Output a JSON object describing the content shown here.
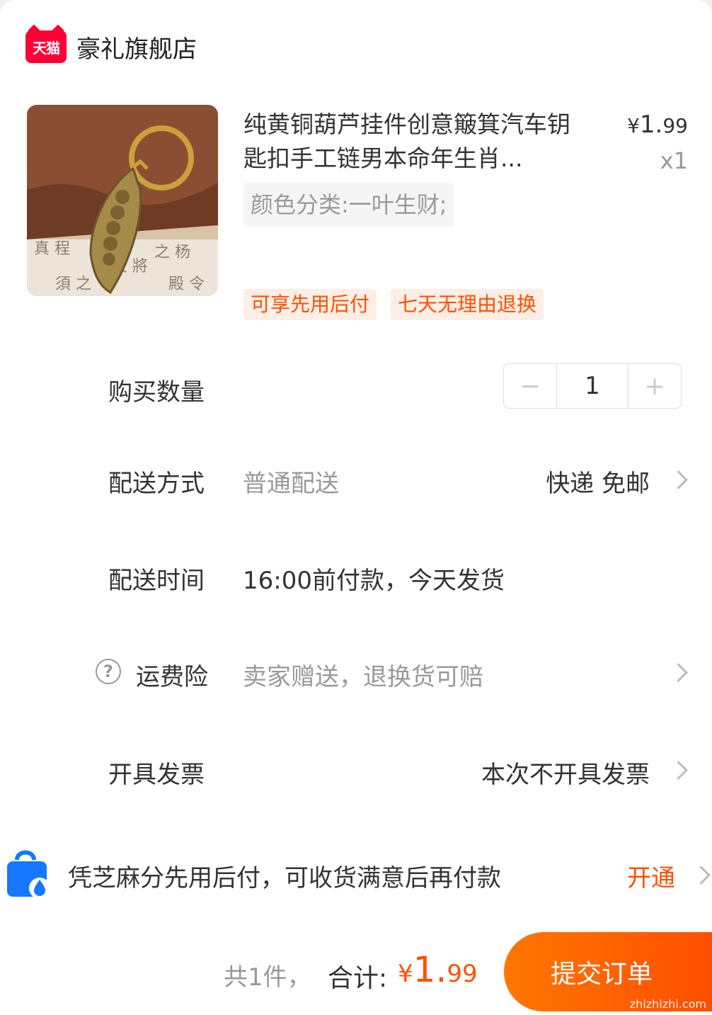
{
  "store": {
    "logo_text": "天猫",
    "name": "豪礼旗舰店"
  },
  "product": {
    "title": "纯黄铜葫芦挂件创意簸箕汽车钥匙扣手工链男本命年生肖...",
    "price_symbol": "¥",
    "price_int": "1.",
    "price_dec": "99",
    "quantity_label": "x1",
    "sku": "颜色分类:一叶生财;",
    "tags": [
      "可享先用后付",
      "七天无理由退换"
    ]
  },
  "quantity": {
    "label": "购买数量",
    "minus": "−",
    "value": "1",
    "plus": "+"
  },
  "delivery_method": {
    "label": "配送方式",
    "value": "普通配送",
    "right": "快递 免邮"
  },
  "delivery_time": {
    "label": "配送时间",
    "value": "16:00前付款，今天发货"
  },
  "shipping_insurance": {
    "icon": "?",
    "label": "运费险",
    "value": "卖家赠送，退换货可赔"
  },
  "invoice": {
    "label": "开具发票",
    "right": "本次不开具发票"
  },
  "pay_later": {
    "text": "凭芝麻分先用后付，可收货满意后再付款",
    "action": "开通"
  },
  "footer": {
    "count": "共1件，",
    "total_label": "合计:",
    "total_symbol": "¥",
    "total_int": "1.",
    "total_dec": "99",
    "submit": "提交订单",
    "watermark": "zhizhizhi.com"
  },
  "colors": {
    "accent": "#ff5000",
    "tmall": "#ff0036",
    "pay_blue": "#1677ff"
  }
}
